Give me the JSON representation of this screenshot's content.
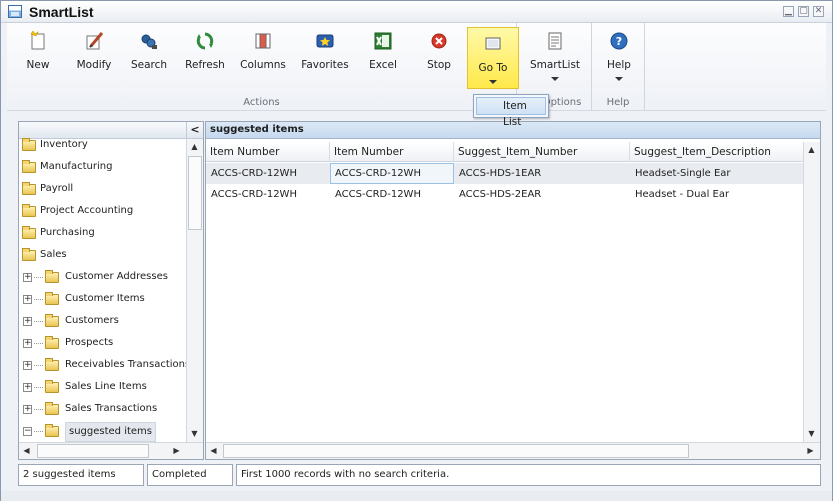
{
  "window": {
    "title": "SmartList"
  },
  "ribbon": {
    "buttons": [
      {
        "label": "New",
        "icon": "new-document-icon"
      },
      {
        "label": "Modify",
        "icon": "modify-icon"
      },
      {
        "label": "Search",
        "icon": "search-binoculars-icon"
      },
      {
        "label": "Refresh",
        "icon": "refresh-icon"
      },
      {
        "label": "Columns",
        "icon": "columns-icon"
      },
      {
        "label": "Favorites",
        "icon": "favorites-star-icon"
      },
      {
        "label": "Excel",
        "icon": "excel-icon"
      },
      {
        "label": "Stop",
        "icon": "stop-icon"
      },
      {
        "label": "Go To",
        "icon": "goto-icon"
      },
      {
        "label": "SmartList",
        "icon": "smartlist-icon"
      },
      {
        "label": "Help",
        "icon": "help-icon"
      }
    ],
    "groups": {
      "actions": "Actions",
      "options": "Options",
      "help": "Help"
    }
  },
  "goto_menu": {
    "items": [
      "Item List"
    ]
  },
  "tree": {
    "collapse_label": "<",
    "items": [
      {
        "label": "Inventory"
      },
      {
        "label": "Manufacturing"
      },
      {
        "label": "Payroll"
      },
      {
        "label": "Project Accounting"
      },
      {
        "label": "Purchasing"
      },
      {
        "label": "Sales"
      },
      {
        "label": "Customer Addresses"
      },
      {
        "label": "Customer Items"
      },
      {
        "label": "Customers"
      },
      {
        "label": "Prospects"
      },
      {
        "label": "Receivables Transactions"
      },
      {
        "label": "Sales Line Items"
      },
      {
        "label": "Sales Transactions"
      },
      {
        "label": "suggested items"
      }
    ]
  },
  "grid": {
    "title": "suggested items",
    "columns": [
      "Item Number",
      "Item Number",
      "Suggest_Item_Number",
      "Suggest_Item_Description"
    ],
    "rows": [
      [
        "ACCS-CRD-12WH",
        "ACCS-CRD-12WH",
        "ACCS-HDS-1EAR",
        "Headset-Single Ear"
      ],
      [
        "ACCS-CRD-12WH",
        "ACCS-CRD-12WH",
        "ACCS-HDS-2EAR",
        "Headset - Dual Ear"
      ]
    ]
  },
  "status": {
    "count": "2 suggested items",
    "state": "Completed",
    "message": "First 1000 records with no search criteria."
  },
  "colors": {
    "goto_active": "#ffe94a",
    "grid_title": "#c6d9ef",
    "border": "#9aa6b6"
  }
}
